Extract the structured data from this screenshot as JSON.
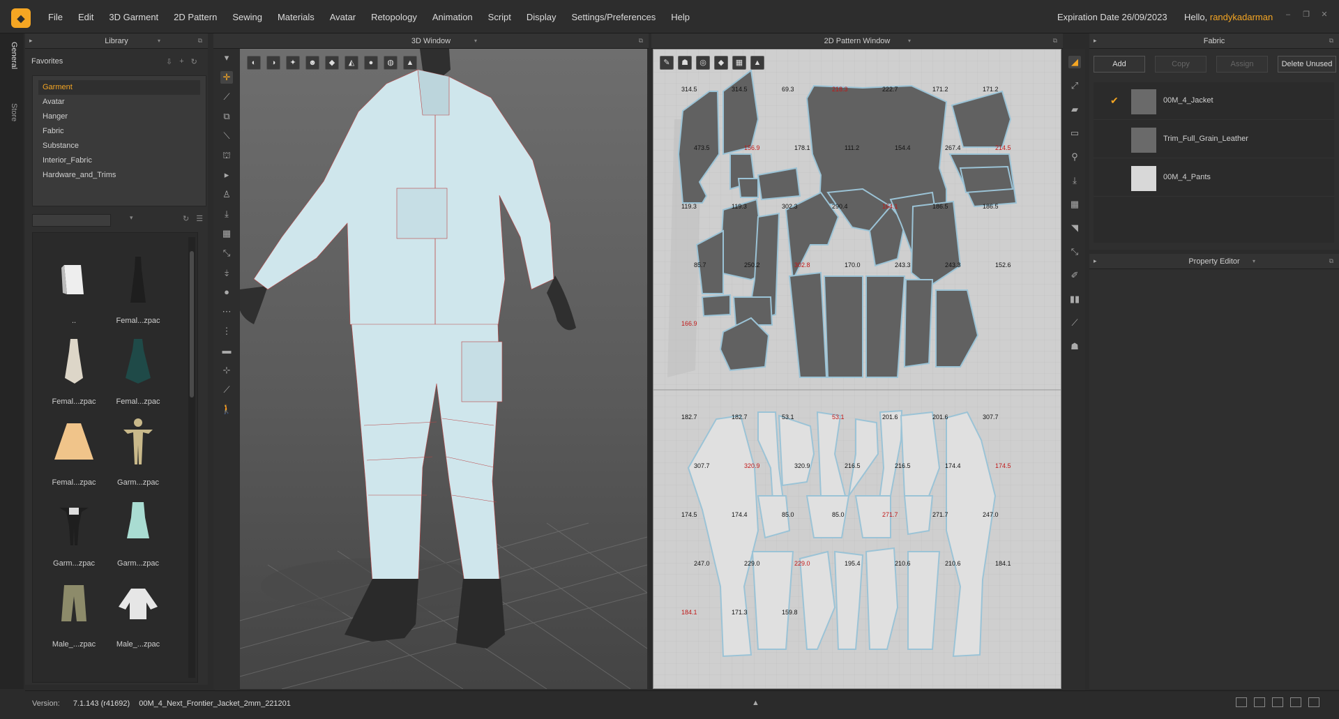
{
  "app": {
    "menu": [
      "File",
      "Edit",
      "3D Garment",
      "2D Pattern",
      "Sewing",
      "Materials",
      "Avatar",
      "Retopology",
      "Animation",
      "Script",
      "Display",
      "Settings/Preferences",
      "Help"
    ],
    "expiration": "Expiration Date 26/09/2023",
    "hello": "Hello,",
    "user": "randykadarman"
  },
  "vtabs": {
    "general": "General",
    "store": "Store"
  },
  "library": {
    "title": "Library",
    "favorites_label": "Favorites",
    "favorites": [
      "Garment",
      "Avatar",
      "Hanger",
      "Fabric",
      "Substance",
      "Interior_Fabric",
      "Hardware_and_Trims"
    ],
    "selected": "Garment",
    "thumbnails": [
      {
        "label": "..",
        "icon": "folder-icon"
      },
      {
        "label": "Femal...zpac",
        "icon": "black-dress-icon"
      },
      {
        "label": "Femal...zpac",
        "icon": "white-dress-icon"
      },
      {
        "label": "Femal...zpac",
        "icon": "green-dress-icon"
      },
      {
        "label": "Femal...zpac",
        "icon": "skirt-icon"
      },
      {
        "label": "Garm...zpac",
        "icon": "avatar-icon"
      },
      {
        "label": "Garm...zpac",
        "icon": "black-outfit-icon"
      },
      {
        "label": "Garm...zpac",
        "icon": "mint-dress-icon"
      },
      {
        "label": "Male_...zpac",
        "icon": "shorts-icon"
      },
      {
        "label": "Male_...zpac",
        "icon": "shirt-icon"
      }
    ]
  },
  "window3d": {
    "title": "3D Window"
  },
  "window2d": {
    "title": "2D Pattern Window"
  },
  "fabric": {
    "title": "Fabric",
    "buttons": {
      "add": "Add",
      "copy": "Copy",
      "assign": "Assign",
      "delete": "Delete Unused"
    },
    "items": [
      {
        "name": "00M_4_Jacket",
        "checked": true,
        "color": "#6a6a6a"
      },
      {
        "name": "Trim_Full_Grain_Leather",
        "checked": false,
        "color": "#6a6a6a"
      },
      {
        "name": "00M_4_Pants",
        "checked": false,
        "color": "#d8d8d8"
      }
    ]
  },
  "property": {
    "title": "Property Editor"
  },
  "status": {
    "version_label": "Version:",
    "version": "7.1.143 (r41692)",
    "file": "00M_4_Next_Frontier_Jacket_2mm_221201"
  },
  "colors": {
    "accent": "#f5a623",
    "garment": "#cfe6ec",
    "avatar": "#2f2f2f",
    "pattern_top": "#616161",
    "pattern_bottom": "#e0e0e0"
  },
  "pattern_labels": {
    "top": [
      "314.5",
      "314.5",
      "69.3",
      "218.3",
      "222.7",
      "171.2",
      "171.2",
      "473.5",
      "156.9",
      "178.1",
      "111.2",
      "154.4",
      "267.4",
      "214.5",
      "119.3",
      "119.3",
      "302.3",
      "290.4",
      "164.1",
      "186.5",
      "186.5",
      "85.7",
      "250.2",
      "302.8",
      "170.0",
      "243.3",
      "243.3",
      "152.6",
      "166.9"
    ],
    "bottom": [
      "182.7",
      "182.7",
      "53.1",
      "53.1",
      "201.6",
      "201.6",
      "307.7",
      "307.7",
      "320.9",
      "320.9",
      "216.5",
      "216.5",
      "174.4",
      "174.5",
      "174.5",
      "174.4",
      "85.0",
      "85.0",
      "271.7",
      "271.7",
      "247.0",
      "247.0",
      "229.0",
      "229.0",
      "195.4",
      "210.6",
      "210.6",
      "184.1",
      "184.1",
      "171.3",
      "159.8"
    ]
  }
}
